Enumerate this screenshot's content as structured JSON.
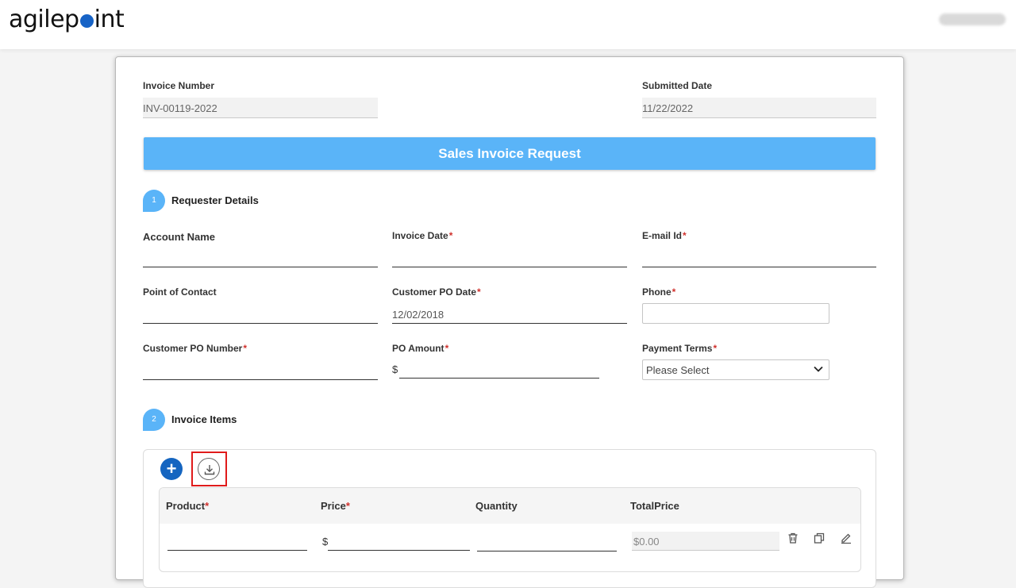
{
  "app": {
    "logo_text_pre": "agilep",
    "logo_text_post": "int"
  },
  "header_fields": {
    "invoice_number_label": "Invoice Number",
    "invoice_number_value": "INV-00119-2022",
    "submitted_date_label": "Submitted Date",
    "submitted_date_value": "11/22/2022"
  },
  "banner": {
    "title": "Sales Invoice Request"
  },
  "sections": {
    "requester": {
      "step": "1",
      "title": "Requester Details"
    },
    "items": {
      "step": "2",
      "title": "Invoice Items"
    }
  },
  "form": {
    "account_name_label": "Account Name",
    "invoice_date_label": "Invoice Date",
    "email_label": "E-mail Id",
    "point_of_contact_label": "Point of Contact",
    "customer_po_date_label": "Customer PO Date",
    "customer_po_date_value": "12/02/2018",
    "phone_label": "Phone",
    "customer_po_number_label": "Customer PO Number",
    "po_amount_label": "PO Amount",
    "po_amount_currency": "$",
    "payment_terms_label": "Payment Terms",
    "payment_terms_value": "Please Select",
    "required_mark": "*"
  },
  "grid": {
    "columns": [
      "Product",
      "Price",
      "Quantity",
      "TotalPrice"
    ],
    "required_mark": "*",
    "row": {
      "price_currency": "$",
      "total_value": "$0.00"
    }
  },
  "icons": {
    "add": "plus-icon",
    "download": "download-icon",
    "delete": "trash-icon",
    "copy": "copy-icon",
    "edit": "pencil-icon",
    "dropdown": "chevron-down-icon"
  },
  "colors": {
    "banner": "#5ab4f8",
    "primary_button": "#1565c0",
    "required": "#d0312d",
    "highlight": "#e01b1b"
  }
}
